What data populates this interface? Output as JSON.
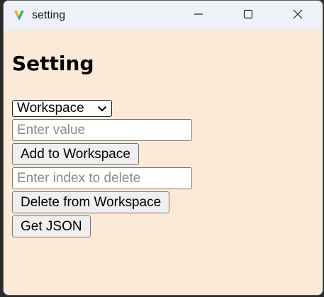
{
  "window": {
    "title": "setting"
  },
  "page": {
    "heading": "Setting"
  },
  "form": {
    "select_value": "Workspace",
    "value_placeholder": "Enter value",
    "add_label": "Add to Workspace",
    "delete_placeholder": "Enter index to delete",
    "delete_label": "Delete from Workspace",
    "json_label": "Get JSON"
  },
  "colors": {
    "background": "#fbead8",
    "titlebar": "#eef1f7"
  }
}
